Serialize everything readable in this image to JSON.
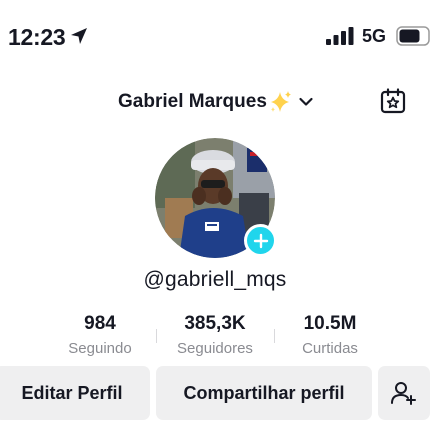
{
  "status_bar": {
    "time": "12:23",
    "network": "5G",
    "icons": [
      "location-arrow-icon",
      "signal-icon",
      "battery-icon"
    ]
  },
  "header": {
    "display_name": "Gabriel Marques",
    "icons": [
      "sparkle-icon",
      "chevron-down-icon",
      "calendar-icon"
    ]
  },
  "profile": {
    "handle": "@gabriell_mqs",
    "avatar_badge_icon": "plus-icon",
    "accent_color": "#20d5ec"
  },
  "stats": [
    {
      "value": "984",
      "label": "Seguindo"
    },
    {
      "value": "385,3K",
      "label": "Seguidores"
    },
    {
      "value": "10.5M",
      "label": "Curtidas"
    }
  ],
  "actions": {
    "edit_label": "Editar Perfil",
    "share_label": "Compartilhar perfil",
    "add_friend_icon": "add-user-icon"
  }
}
